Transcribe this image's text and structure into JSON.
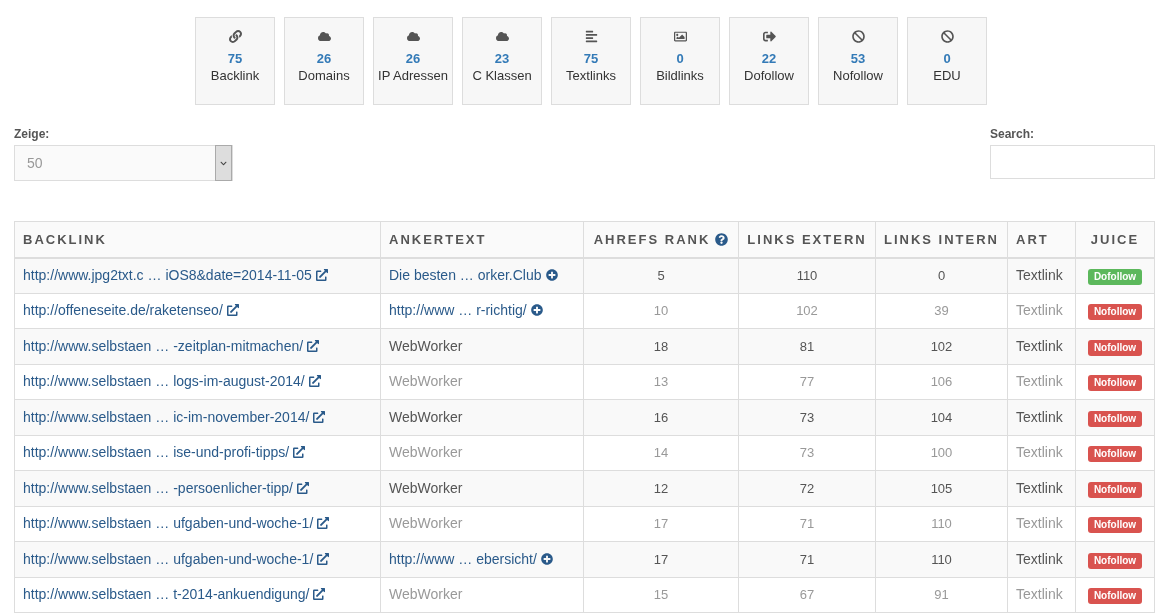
{
  "stats": [
    {
      "kind": "link",
      "value": "75",
      "label": "Backlink"
    },
    {
      "kind": "cloud",
      "value": "26",
      "label": "Domains"
    },
    {
      "kind": "cloud",
      "value": "26",
      "label": "IP Adressen"
    },
    {
      "kind": "cloud",
      "value": "23",
      "label": "C Klassen"
    },
    {
      "kind": "text",
      "value": "75",
      "label": "Textlinks"
    },
    {
      "kind": "image",
      "value": "0",
      "label": "Bildlinks"
    },
    {
      "kind": "out",
      "value": "22",
      "label": "Dofollow"
    },
    {
      "kind": "ban",
      "value": "53",
      "label": "Nofollow"
    },
    {
      "kind": "ban",
      "value": "0",
      "label": "EDU"
    }
  ],
  "length_select": {
    "label": "Zeige:",
    "value": "50"
  },
  "search": {
    "label": "Search:"
  },
  "table": {
    "columns": [
      {
        "label": "BACKLINK",
        "help": false
      },
      {
        "label": "ANKERTEXT",
        "help": false
      },
      {
        "label": "AHREFS RANK",
        "help": true
      },
      {
        "label": "LINKS EXTERN",
        "help": false
      },
      {
        "label": "LINKS INTERN",
        "help": false
      },
      {
        "label": "ART",
        "help": false
      },
      {
        "label": "JUICE",
        "help": false
      }
    ],
    "rows": [
      {
        "backlink": "http://www.jpg2txt.c … iOS8&date=2014-11-05",
        "anchor": "Die besten … orker.Club",
        "anchor_more": true,
        "rank": "5",
        "extern": "110",
        "intern": "0",
        "art": "Textlink",
        "juice": {
          "label": "Dofollow",
          "color": "#5cb85c"
        }
      },
      {
        "backlink": "http://offeneseite.de/raketenseo/",
        "anchor": "http://www … r-richtig/",
        "anchor_more": true,
        "rank": "10",
        "extern": "102",
        "intern": "39",
        "art": "Textlink",
        "juice": {
          "label": "Nofollow",
          "color": "#d9534f"
        }
      },
      {
        "backlink": "http://www.selbstaen … -zeitplan-mitmachen/",
        "anchor": "WebWorker",
        "anchor_more": false,
        "rank": "18",
        "extern": "81",
        "intern": "102",
        "art": "Textlink",
        "juice": {
          "label": "Nofollow",
          "color": "#d9534f"
        }
      },
      {
        "backlink": "http://www.selbstaen … logs-im-august-2014/",
        "anchor": "WebWorker",
        "anchor_more": false,
        "rank": "13",
        "extern": "77",
        "intern": "106",
        "art": "Textlink",
        "juice": {
          "label": "Nofollow",
          "color": "#d9534f"
        }
      },
      {
        "backlink": "http://www.selbstaen … ic-im-november-2014/",
        "anchor": "WebWorker",
        "anchor_more": false,
        "rank": "16",
        "extern": "73",
        "intern": "104",
        "art": "Textlink",
        "juice": {
          "label": "Nofollow",
          "color": "#d9534f"
        }
      },
      {
        "backlink": "http://www.selbstaen … ise-und-profi-tipps/",
        "anchor": "WebWorker",
        "anchor_more": false,
        "rank": "14",
        "extern": "73",
        "intern": "100",
        "art": "Textlink",
        "juice": {
          "label": "Nofollow",
          "color": "#d9534f"
        }
      },
      {
        "backlink": "http://www.selbstaen … -persoenlicher-tipp/",
        "anchor": "WebWorker",
        "anchor_more": false,
        "rank": "12",
        "extern": "72",
        "intern": "105",
        "art": "Textlink",
        "juice": {
          "label": "Nofollow",
          "color": "#d9534f"
        }
      },
      {
        "backlink": "http://www.selbstaen … ufgaben-und-woche-1/",
        "anchor": "WebWorker",
        "anchor_more": false,
        "rank": "17",
        "extern": "71",
        "intern": "110",
        "art": "Textlink",
        "juice": {
          "label": "Nofollow",
          "color": "#d9534f"
        }
      },
      {
        "backlink": "http://www.selbstaen … ufgaben-und-woche-1/",
        "anchor": "http://www … ebersicht/",
        "anchor_more": true,
        "rank": "17",
        "extern": "71",
        "intern": "110",
        "art": "Textlink",
        "juice": {
          "label": "Nofollow",
          "color": "#d9534f"
        }
      },
      {
        "backlink": "http://www.selbstaen … t-2014-ankuendigung/",
        "anchor": "WebWorker",
        "anchor_more": false,
        "rank": "15",
        "extern": "67",
        "intern": "91",
        "art": "Textlink",
        "juice": {
          "label": "Nofollow",
          "color": "#d9534f"
        }
      }
    ]
  }
}
